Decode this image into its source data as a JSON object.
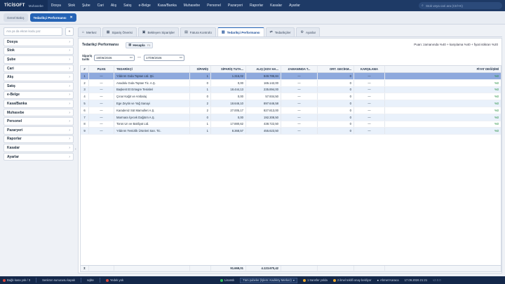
{
  "app": {
    "brand": "TİCİSOFT",
    "module": "Muhasebe"
  },
  "topmenu": [
    "Dosya",
    "Stok",
    "Şube",
    "Cari",
    "Alış",
    "Satış",
    "e-Belge",
    "Kasa/Banka",
    "Muhasebe",
    "Personel",
    "Pazaryeri",
    "Raporlar",
    "Kasalar",
    "Ayarlar"
  ],
  "search": {
    "placeholder": "Stok veya cari ara (Ctrl+K)"
  },
  "pagetabs": [
    {
      "label": "Genel Bakış"
    },
    {
      "label": "Tedarikçi Performansı"
    }
  ],
  "sidebar": {
    "search_placeholder": "Ara ya da ekran kodu yaz",
    "items": [
      "Dosya",
      "Stok",
      "Şube",
      "Cari",
      "Alış",
      "Satış",
      "e-Belge",
      "Kasa/Banka",
      "Muhasebe",
      "Personel",
      "Pazaryeri",
      "Raporlar",
      "Kasalar",
      "Ayarlar"
    ]
  },
  "maintabs": [
    {
      "label": "Merkez",
      "icon": "home-icon"
    },
    {
      "label": "Sipariş Önerisi",
      "icon": "grid-icon"
    },
    {
      "label": "Bekleyen Siparişler",
      "icon": "box-icon"
    },
    {
      "label": "Fatura Kontrolü",
      "icon": "document-icon"
    },
    {
      "label": "Tedarikçi Performansı",
      "icon": "chart-icon"
    },
    {
      "label": "Tedarikçiler",
      "icon": "handshake-icon"
    },
    {
      "label": "Ayarlar",
      "icon": "gear-icon"
    }
  ],
  "panel": {
    "title": "Tedarikçi Performansı",
    "calc_label": "Hesapla",
    "calc_badge": "F5",
    "formula": "Puan: zamanında %40 + karşılama %40 + fiyat istikrarı %20",
    "filter_label": "Sipariş tarihi",
    "date_from": "19/06/2026",
    "date_to": "17/09/2026",
    "date_sep": "—"
  },
  "table": {
    "headers": [
      "#",
      "PUAN",
      "TEDARİKÇİ",
      "SİPARİŞ",
      "SİPARİŞ TUTA...",
      "ALIŞ (KDV HA...",
      "ZAMANINDA T...",
      "ORT. GECİKM...",
      "KARŞILAMA",
      "FİYAT DEĞİŞİMİ"
    ],
    "rows": [
      [
        "1",
        "—",
        "Yıldırım Gıda Toptan Ltd. Şti.",
        "1",
        "1.315,02",
        "849.785,84",
        "—",
        "0",
        "—",
        "%0"
      ],
      [
        "2",
        "—",
        "Anadolu Gıda Toptan Tic. A.Ş.",
        "0",
        "0,00",
        "165.142,00",
        "—",
        "0",
        "—",
        "%0"
      ],
      [
        "3",
        "—",
        "Başkent Et Entegre Tesisleri",
        "1",
        "18.444,13",
        "235.894,00",
        "—",
        "0",
        "—",
        "%0"
      ],
      [
        "4",
        "—",
        "Çınar Kağıt ve Ambalaj",
        "0",
        "0,00",
        "57.934,50",
        "—",
        "0",
        "—",
        "%0"
      ],
      [
        "5",
        "—",
        "Ege Zeytin ve Yağ Sanayi",
        "2",
        "18.646,10",
        "897.646,58",
        "—",
        "0",
        "—",
        "%0"
      ],
      [
        "6",
        "—",
        "Karadeniz Süt Mamulleri A.Ş.",
        "2",
        "27.005,17",
        "827.813,00",
        "—",
        "0",
        "—",
        "%0"
      ],
      [
        "7",
        "—",
        "Marmara İçecek Dağıtım A.Ş.",
        "0",
        "0,00",
        "192.308,50",
        "—",
        "0",
        "—",
        "%0"
      ],
      [
        "8",
        "—",
        "Toros Un ve Bakliyat Ltd.",
        "1",
        "17.880,62",
        "438.722,50",
        "—",
        "0",
        "—",
        "%0"
      ],
      [
        "9",
        "—",
        "Yıldırım Temizlik Ürünleri San. Tic.",
        "1",
        "8.368,57",
        "455.623,50",
        "—",
        "0",
        "—",
        "%0"
      ]
    ],
    "total": {
      "label": "Σ",
      "order_total": "91.669,01",
      "purchase_total": "4.123.670,42"
    }
  },
  "statusbar": {
    "items": [
      "Bağlı kasa yok / 3",
      "Senkron sunucusu kapalı",
      "sqlite",
      "Yedek yok",
      "Lisanslı"
    ],
    "branch": "Tüm şubeler (İşlem: Kadıköy Merkez)",
    "alerts": [
      "1 transfer yolda",
      "2 ilmel teklifi onay bekliyor"
    ],
    "user": "Ahmet Karaca",
    "datetime": "17.09.2026 21:21",
    "version": "v2.0.0"
  },
  "colors": {
    "accent": "#2563b5",
    "topbar": "#1e3a66",
    "selected_row": "#8ea9dd",
    "positive": "#1f8a3b"
  }
}
